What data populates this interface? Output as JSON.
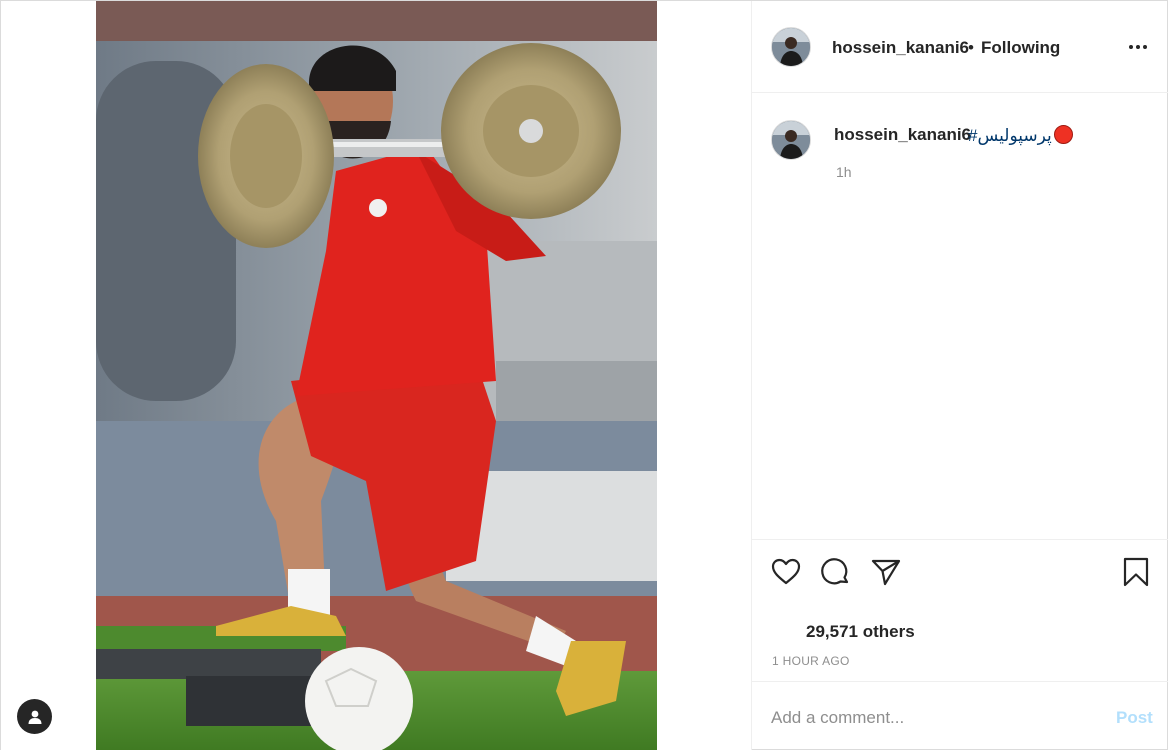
{
  "header": {
    "username": "hossein_kanani6",
    "separator": "•",
    "follow_status": "Following"
  },
  "caption": {
    "username": "hossein_kanani6",
    "hashtag": "#پرسپولیس",
    "time": "1h"
  },
  "engagement": {
    "likes": "29,571 others",
    "posted": "1 HOUR AGO"
  },
  "comment": {
    "placeholder": "Add a comment...",
    "post_label": "Post"
  },
  "icons": {
    "like": "heart-icon",
    "comment": "comment-bubble-icon",
    "share": "paper-plane-icon",
    "save": "bookmark-icon",
    "more": "more-options-icon",
    "profile": "user-silhouette-icon"
  },
  "colors": {
    "link": "#00376b",
    "post_disabled": "#b2dffc",
    "muted": "#8e8e8e",
    "jersey": "#e0231e"
  }
}
